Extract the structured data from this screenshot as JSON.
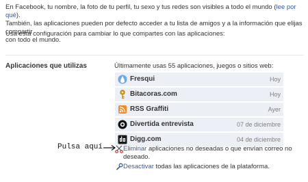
{
  "intro": {
    "text1": "En Facebook, tu nombre, la foto de tu perfil, tu sexo y tus redes son visibles a todo el mundo (",
    "link": "lee por qué",
    "text2": ").",
    "line2": "También, las aplicaciones pueden por defecto acceder a tu lista de amigos y a la información que elijas compartir",
    "line3": "con todo el mundo."
  },
  "config_text": "Usa esta configuración para cambiar lo que compartes con las aplicaciones:",
  "section": {
    "label": "Aplicaciones que utilizas",
    "summary": "Últimamente usas 55 aplicaciones, juegos o sitios web:"
  },
  "apps": [
    {
      "name": "Fresqui",
      "when": "Hoy",
      "icon": "fresqui-drop-icon"
    },
    {
      "name": "Bitacoras.com",
      "when": "Hoy",
      "icon": "bitacoras-key-icon"
    },
    {
      "name": "RSS Graffiti",
      "when": "Ayer",
      "icon": "rss-graffiti-icon"
    },
    {
      "name": "Divertida entrevista",
      "when": "07 de diciembre",
      "icon": "entrevista-camera-icon"
    },
    {
      "name": "Digg.com",
      "when": "04 de diciembre",
      "icon": "digg-icon"
    }
  ],
  "annotation": "Pulsa aquí",
  "actions": {
    "remove_link": "Eliminar",
    "remove_text1": " aplicaciones no deseadas o que envían correo no",
    "remove_text2": "deseado.",
    "disable_link": "Desactivar",
    "disable_text": " todas las aplicaciones de la plataforma."
  },
  "colors": {
    "link": "#3b5998",
    "row_bg": "#eceff5",
    "muted": "#808080"
  }
}
